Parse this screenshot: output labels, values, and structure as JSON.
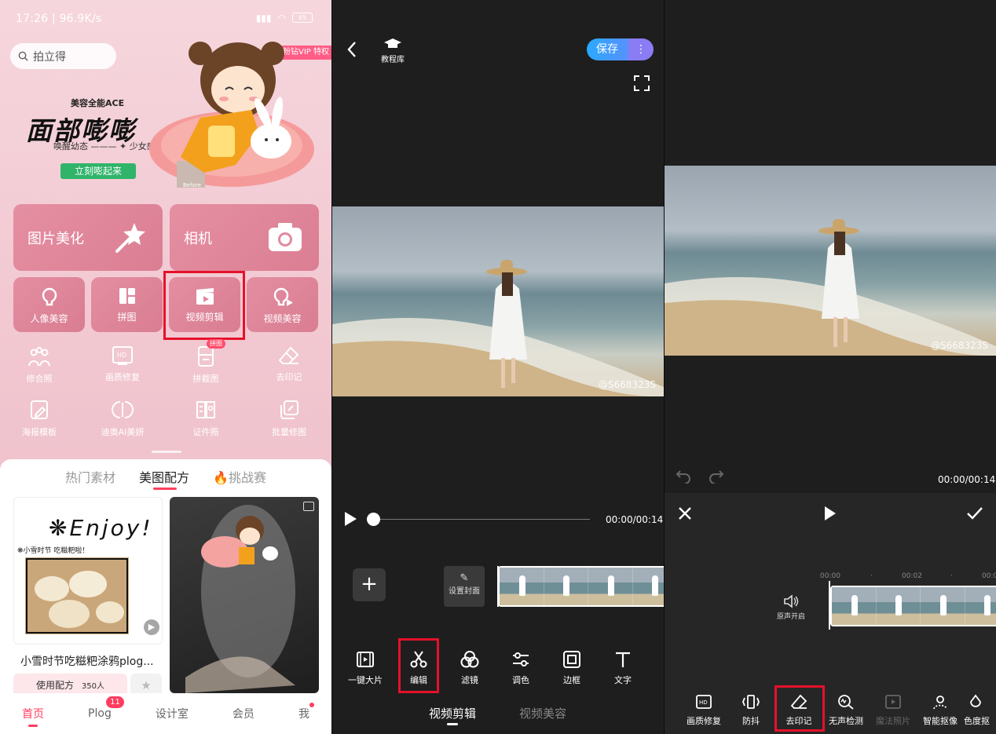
{
  "home": {
    "status_time": "17:26 | 96.9K/s",
    "status_battery": "65",
    "search_placeholder": "拍立得",
    "banner": {
      "brand": "美容全能ACE",
      "title": "面部嘭嘭",
      "subtitle": "唤醒幼态 ——— ✦ 少女感",
      "button": "立刻嘭起来",
      "badge": "粉钻VIP 特权",
      "before_tag": "Before"
    },
    "big_cards": [
      {
        "label": "图片美化",
        "icon": "magic-wand-icon"
      },
      {
        "label": "相机",
        "icon": "camera-icon"
      }
    ],
    "small_cards": [
      {
        "label": "人像美容",
        "icon": "portrait-icon"
      },
      {
        "label": "拼图",
        "icon": "collage-icon"
      },
      {
        "label": "视频剪辑",
        "icon": "video-clip-icon"
      },
      {
        "label": "视频美容",
        "icon": "video-beauty-icon"
      }
    ],
    "grid_row1": [
      {
        "label": "修合照",
        "icon": "group-photo-icon"
      },
      {
        "label": "画质修复",
        "icon": "hd-icon"
      },
      {
        "label": "拼截图",
        "icon": "screenshot-stitch-icon",
        "badge": "拼图"
      },
      {
        "label": "去印记",
        "icon": "eraser-icon"
      }
    ],
    "grid_row2": [
      {
        "label": "海报模板",
        "icon": "poster-icon"
      },
      {
        "label": "迪奥AI美妍",
        "icon": "dior-icon"
      },
      {
        "label": "证件照",
        "icon": "id-photo-icon"
      },
      {
        "label": "批量修图",
        "icon": "batch-edit-icon"
      }
    ],
    "feed_tabs": [
      "热门素材",
      "美图配方",
      "🔥挑战赛"
    ],
    "feed_tab_active": 1,
    "card_a_text": "❋Enjoy!",
    "card_a_note": "❋小雪时节 吃糍粑啦！",
    "card_caption": "小雪时节吃糍粑涂鸦plog...",
    "use_button": "使用配方",
    "use_count": "350人",
    "nav": [
      {
        "label": "首页"
      },
      {
        "label": "Plog",
        "badge": "11"
      },
      {
        "label": "设计室"
      },
      {
        "label": "会员"
      },
      {
        "label": "我"
      }
    ]
  },
  "editor": {
    "tutorial": "教程库",
    "save": "保存",
    "watermark": "@S668323S",
    "time": "00:00/00:14",
    "cover": "设置封面",
    "tools": [
      {
        "label": "一键大片",
        "icon": "film-icon"
      },
      {
        "label": "编辑",
        "icon": "scissors-icon"
      },
      {
        "label": "滤镜",
        "icon": "filter-icon"
      },
      {
        "label": "调色",
        "icon": "adjust-icon"
      },
      {
        "label": "边框",
        "icon": "frame-icon"
      },
      {
        "label": "文字",
        "icon": "text-icon"
      }
    ],
    "bottom_tabs": [
      "视频剪辑",
      "视频美容"
    ]
  },
  "edit_panel": {
    "watermark": "@S668323S",
    "time": "00:00/00:14",
    "ticks": [
      "00:00",
      "00:02",
      "00:0"
    ],
    "audio": "原声开启",
    "tools": [
      {
        "label": "画质修复",
        "icon": "hd-icon"
      },
      {
        "label": "防抖",
        "icon": "stabilize-icon"
      },
      {
        "label": "去印记",
        "icon": "eraser-icon"
      },
      {
        "label": "无声检测",
        "icon": "silence-detect-icon"
      },
      {
        "label": "魔法照片",
        "icon": "magic-photo-icon"
      },
      {
        "label": "智能抠像",
        "icon": "cutout-icon"
      },
      {
        "label": "色度抠",
        "icon": "chroma-icon"
      }
    ]
  }
}
